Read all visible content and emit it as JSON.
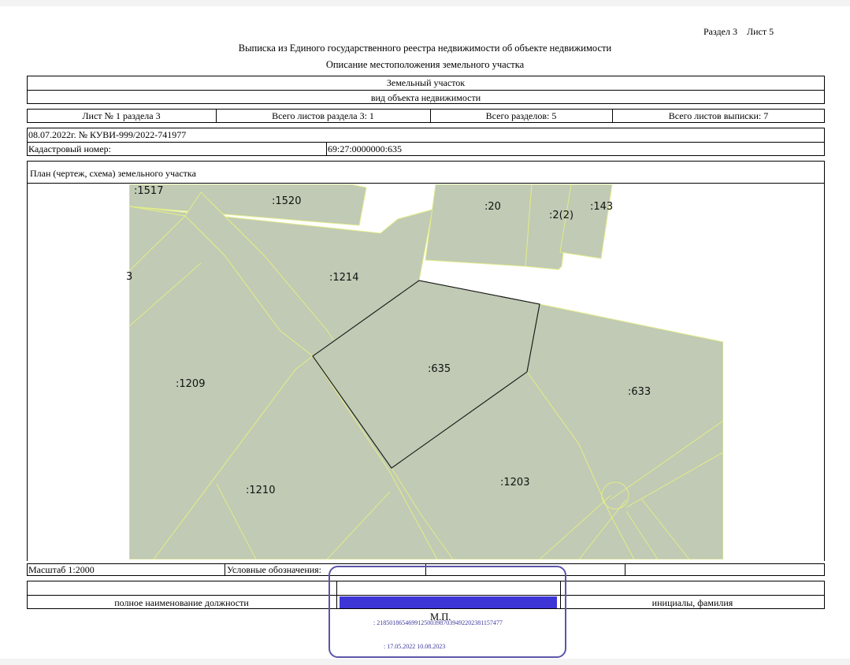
{
  "header": {
    "section_sheet": "Раздел 3    Лист 5",
    "title": "Выписка из Единого государственного реестра недвижимости об объекте недвижимости",
    "subtitle": "Описание местоположения земельного участка"
  },
  "object": {
    "type": "Земельный участок",
    "type_caption": "вид объекта недвижимости"
  },
  "sheets": {
    "sheet_of_section": "Лист № 1 раздела 3",
    "total_section_sheets": "Всего листов раздела 3: 1",
    "total_sections": "Всего разделов: 5",
    "total_extract_sheets": "Всего листов выписки: 7"
  },
  "record": {
    "date_number": "08.07.2022г. № КУВИ-999/2022-741977",
    "cadastral_label": "Кадастровый номер:",
    "cadastral_value": "69:27:0000000:635"
  },
  "plan": {
    "heading": "План (чертеж, схема) земельного участка",
    "labels": {
      "p1520": ":1520",
      "p20": ":20",
      "p2_2": ":2(2)",
      "p143": ":143",
      "p1214": ":1214",
      "p635": ":635",
      "p1209": ":1209",
      "p633": ":633",
      "p1203": ":1203",
      "p1210": ":1210",
      "p1517_partial": ":1517",
      "edge_3": "3"
    },
    "colors": {
      "parcel_fill": "#c0cab4",
      "parcel_border": "#e2ec88",
      "subject_border": "#1a1a1a"
    }
  },
  "footer": {
    "scale": "Масштаб 1:2000",
    "legend": "Условные обозначения:",
    "position_caption": "полное наименование должности",
    "initials_caption": "инициалы, фамилия"
  },
  "stamp": {
    "mp": "М.П.",
    "serial": ": 21850186546991250039870394922023811574​77",
    "dates": ":   17.05.2022    10.08.2023",
    "colors": {
      "border": "#5a55a8",
      "bar": "#3d35d6"
    }
  }
}
